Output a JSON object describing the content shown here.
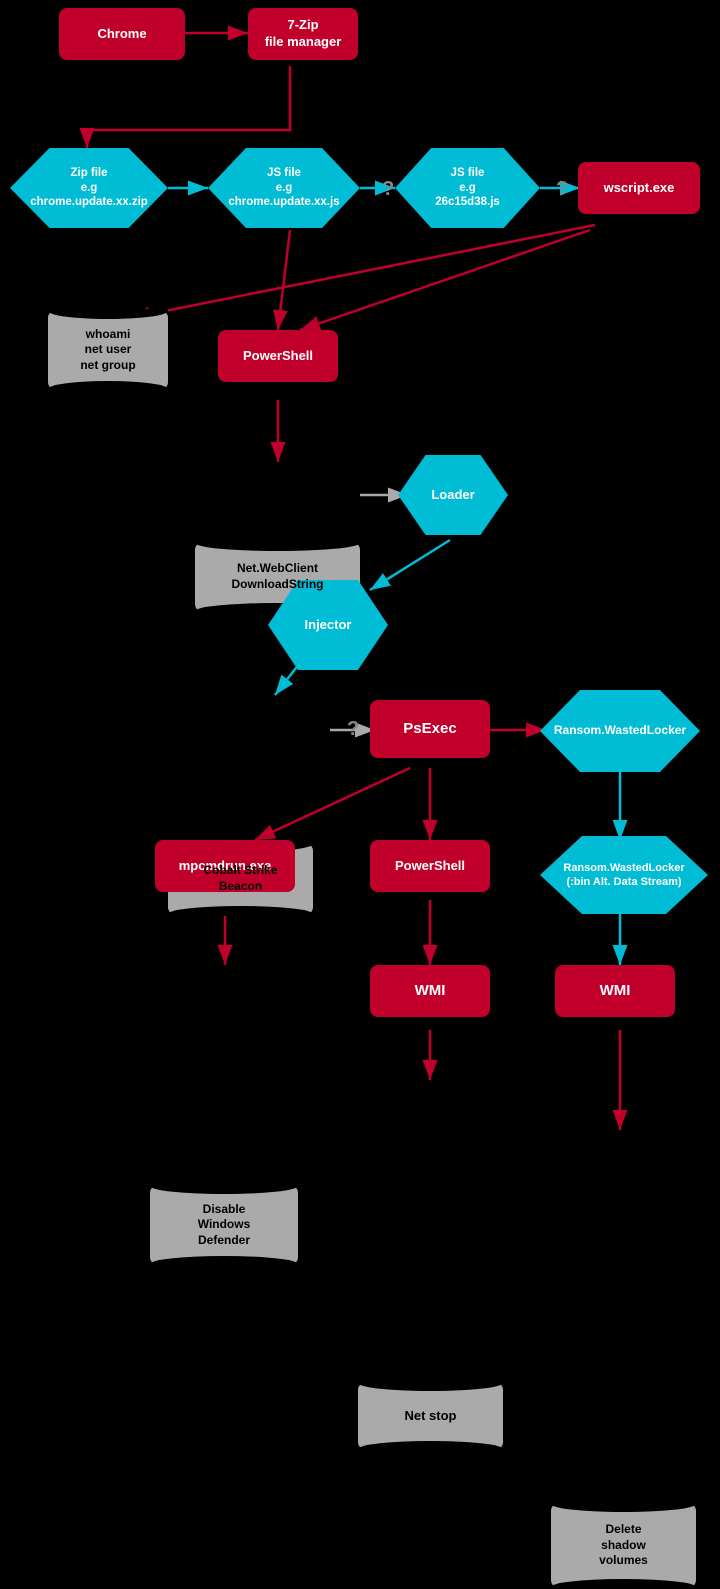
{
  "nodes": {
    "chrome": {
      "label": "Chrome"
    },
    "zip_manager": {
      "label": "7-Zip\nfile manager"
    },
    "zip_file": {
      "label": "Zip file\ne.g\nchrome.update.xx.zip"
    },
    "js_file1": {
      "label": "JS file\ne.g\nchrome.update.xx.js"
    },
    "js_file2": {
      "label": "JS file\ne.g\n26c15d38.js"
    },
    "wscript": {
      "label": "wscript.exe"
    },
    "whoami": {
      "label": "whoami\nnet user\nnet group"
    },
    "powershell1": {
      "label": "PowerShell"
    },
    "netwebclient": {
      "label": "Net.WebClient\nDownloadString"
    },
    "loader": {
      "label": "Loader"
    },
    "injector": {
      "label": "Injector"
    },
    "cobalt": {
      "label": "Cobalt Strike\nBeacon"
    },
    "psexec": {
      "label": "PsExec"
    },
    "ransom_wasted1": {
      "label": "Ransom.WastedLocker"
    },
    "ransom_wasted2": {
      "label": "Ransom.WastedLocker\n(:bin Alt. Data Stream)"
    },
    "mpcmdrun": {
      "label": "mpcmdrun.exe"
    },
    "powershell2": {
      "label": "PowerShell"
    },
    "wmi1": {
      "label": "WMI"
    },
    "wmi2": {
      "label": "WMI"
    },
    "disable_defender": {
      "label": "Disable\nWindows\nDefender"
    },
    "net_stop": {
      "label": "Net stop"
    },
    "delete_shadow": {
      "label": "Delete\nshadow\nvolumes"
    }
  }
}
